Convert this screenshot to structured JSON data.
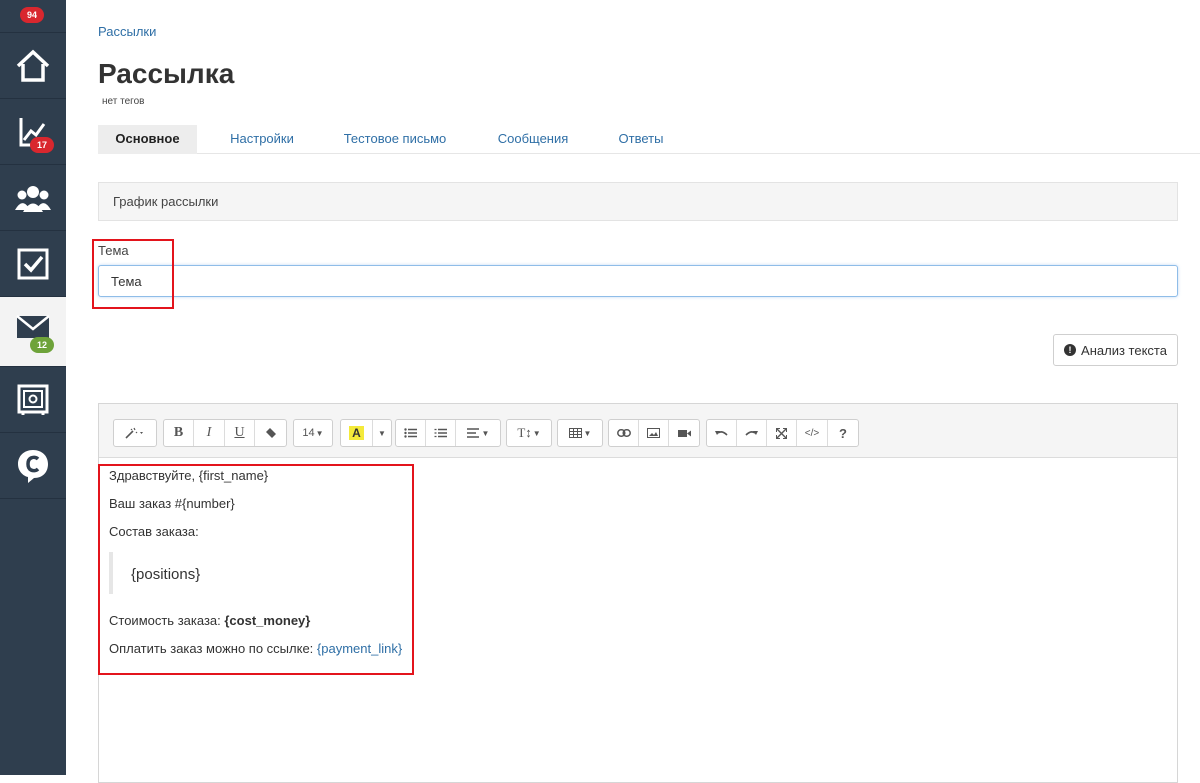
{
  "sidebar": {
    "top_badge": "94",
    "items": [
      {
        "icon": "home-icon",
        "badge": ""
      },
      {
        "icon": "chart-icon",
        "badge": "17"
      },
      {
        "icon": "users-icon",
        "badge": ""
      },
      {
        "icon": "tasks-icon",
        "badge": ""
      },
      {
        "icon": "mail-icon",
        "badge": "12",
        "active": true
      },
      {
        "icon": "safe-icon",
        "badge": ""
      },
      {
        "icon": "chat-icon",
        "badge": ""
      }
    ]
  },
  "breadcrumb": "Рассылки",
  "page": {
    "title": "Рассылка",
    "tags": "нет тегов"
  },
  "tabs": [
    "Основное",
    "Настройки",
    "Тестовое письмо",
    "Сообщения",
    "Ответы"
  ],
  "schedule_panel": "График рассылки",
  "subject": {
    "label": "Тема",
    "value": "Тема"
  },
  "analyze_button": "Анализ текста",
  "toolbar": {
    "font_size": "14"
  },
  "email_body": {
    "greeting_prefix": "Здравствуйте, ",
    "greeting_var": "{first_name}",
    "order_line": "Ваш заказ #{number}",
    "composition_label": "Состав заказа:",
    "positions": "{positions}",
    "cost_prefix": "Стоимость заказа: ",
    "cost_var": "{cost_money}",
    "pay_prefix": "Оплатить заказ можно по ссылке: ",
    "pay_link": "{payment_link}"
  },
  "colors": {
    "sidebar": "#2f3e4e",
    "badge_red": "#d9272e",
    "badge_green": "#6ea33a",
    "link": "#2f6fa6",
    "highlight": "#e3141c"
  }
}
